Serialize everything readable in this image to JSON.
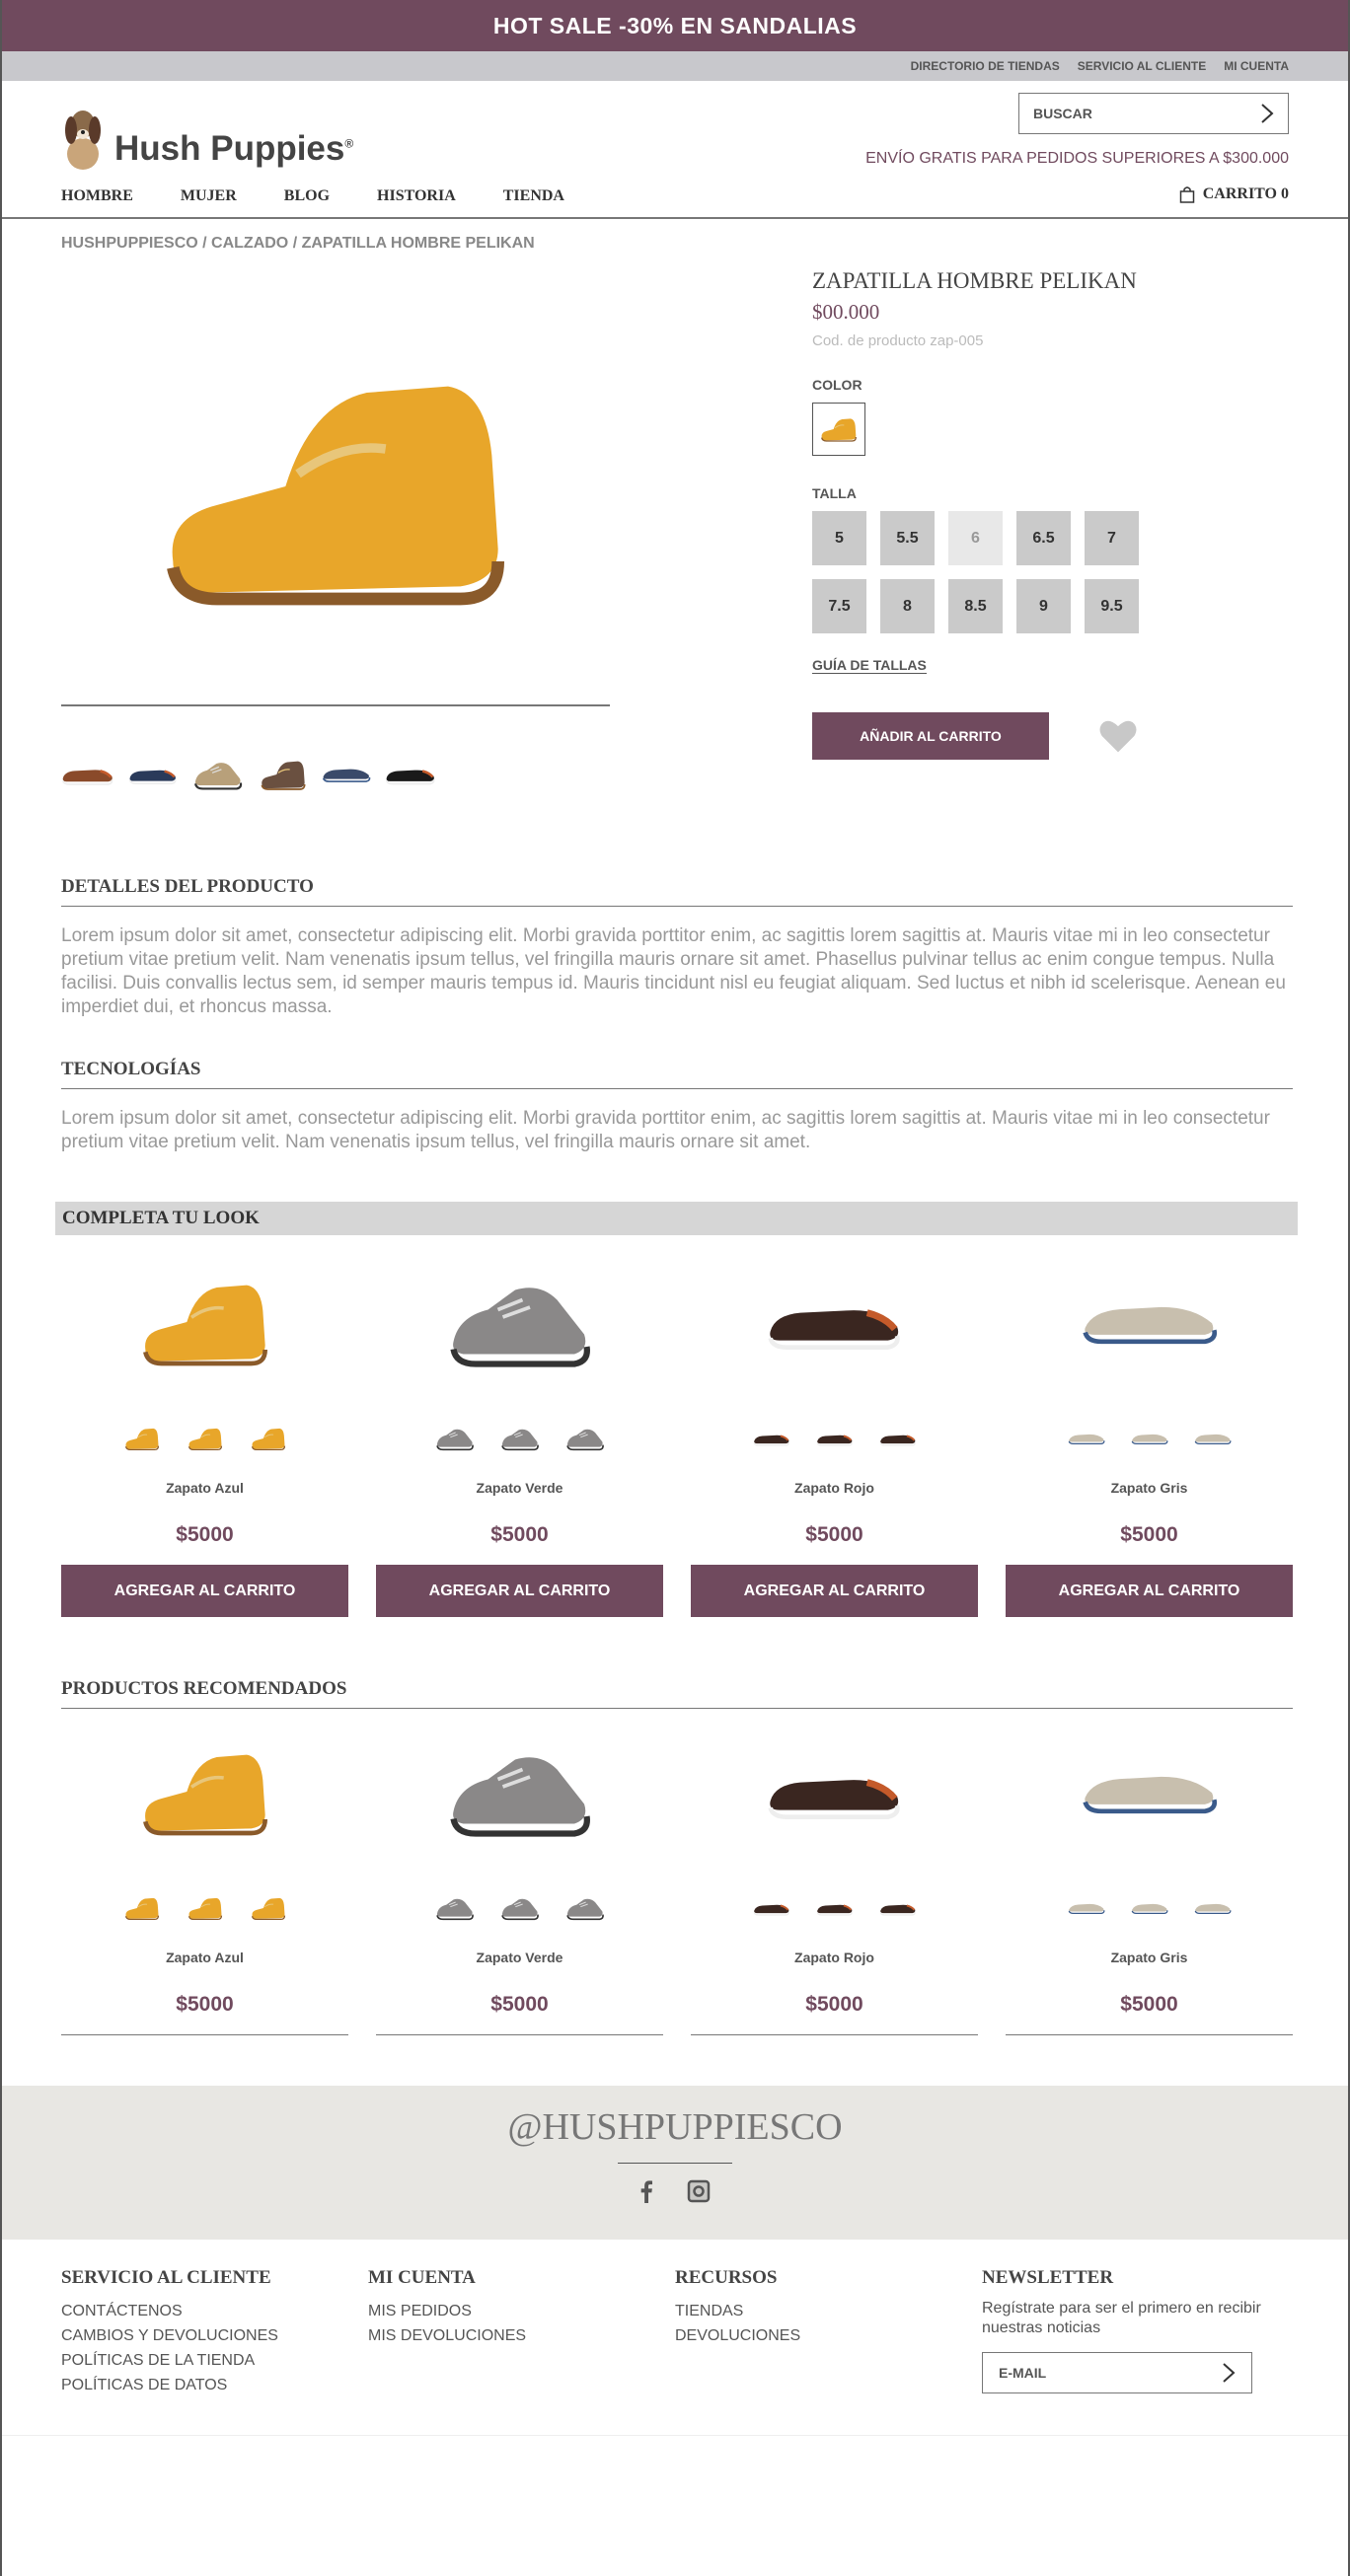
{
  "promo": "HOT SALE -30% EN SANDALIAS",
  "util_links": [
    "DIRECTORIO DE TIENDAS",
    "SERVICIO AL CLIENTE",
    "MI CUENTA"
  ],
  "brand": "Hush Puppies",
  "brand_mark": "®",
  "search": {
    "placeholder": "BUSCAR"
  },
  "shipping": "ENVÍO GRATIS PARA PEDIDOS SUPERIORES A $300.000",
  "nav": [
    "HOMBRE",
    "MUJER",
    "BLOG",
    "HISTORIA",
    "TIENDA"
  ],
  "cart": "CARRITO 0",
  "breadcrumb": "HUSHPUPPIESCO / CALZADO / ZAPATILLA HOMBRE PELIKAN",
  "product": {
    "name": "ZAPATILLA HOMBRE PELIKAN",
    "price": "$00.000",
    "code": "Cod. de producto zap-005",
    "color_label": "COLOR",
    "size_label": "TALLA",
    "sizes": [
      "5",
      "5.5",
      "6",
      "6.5",
      "7",
      "7.5",
      "8",
      "8.5",
      "9",
      "9.5"
    ],
    "guide": "GUÍA DE TALLAS",
    "add": "AÑADIR AL CARRITO"
  },
  "details": {
    "title": "DETALLES DEL PRODUCTO",
    "text": "Lorem ipsum dolor sit amet, consectetur adipiscing elit. Morbi gravida porttitor enim, ac sagittis lorem sagittis at. Mauris vitae mi in leo consectetur pretium vitae pretium velit. Nam venenatis ipsum tellus, vel fringilla mauris ornare sit amet. Phasellus pulvinar tellus ac enim congue tempus. Nulla facilisi. Duis convallis lectus sem, id semper mauris tempus id. Mauris tincidunt nisl eu feugiat aliquam. Sed luctus et nibh id scelerisque. Aenean eu imperdiet dui, et rhoncus massa."
  },
  "tech": {
    "title": "TECNOLOGÍAS",
    "text": "Lorem ipsum dolor sit amet, consectetur adipiscing elit. Morbi gravida porttitor enim, ac sagittis lorem sagittis at. Mauris vitae mi in leo consectetur pretium vitae pretium velit. Nam venenatis ipsum tellus, vel fringilla mauris ornare sit amet."
  },
  "look": {
    "title": "COMPLETA TU LOOK",
    "cards": [
      {
        "name": "Zapato Azul",
        "price": "$5000",
        "button": "AGREGAR AL CARRITO"
      },
      {
        "name": "Zapato Verde",
        "price": "$5000",
        "button": "AGREGAR AL CARRITO"
      },
      {
        "name": "Zapato Rojo",
        "price": "$5000",
        "button": "AGREGAR AL CARRITO"
      },
      {
        "name": "Zapato Gris",
        "price": "$5000",
        "button": "AGREGAR AL CARRITO"
      }
    ]
  },
  "recommended": {
    "title": "PRODUCTOS RECOMENDADOS",
    "cards": [
      {
        "name": "Zapato Azul",
        "price": "$5000"
      },
      {
        "name": "Zapato Verde",
        "price": "$5000"
      },
      {
        "name": "Zapato Rojo",
        "price": "$5000"
      },
      {
        "name": "Zapato Gris",
        "price": "$5000"
      }
    ]
  },
  "social": {
    "handle": "@HUSHPUPPIESCO",
    "icons": [
      "facebook-icon",
      "instagram-icon"
    ]
  },
  "footer": {
    "col1": {
      "title": "SERVICIO AL CLIENTE",
      "links": [
        "CONTÁCTENOS",
        "CAMBIOS Y DEVOLUCIONES",
        "POLÍTICAS DE LA TIENDA",
        "POLÍTICAS DE DATOS"
      ]
    },
    "col2": {
      "title": "MI CUENTA",
      "links": [
        "MIS PEDIDOS",
        "MIS DEVOLUCIONES"
      ]
    },
    "col3": {
      "title": "RECURSOS",
      "links": [
        "TIENDAS",
        "DEVOLUCIONES"
      ]
    },
    "col4": {
      "title": "NEWSLETTER",
      "text": "Regístrate para ser el primero en recibir nuestras noticias",
      "email_placeholder": "E-MAIL"
    }
  },
  "colors": {
    "accent": "#704a5e",
    "size_bg": "#cacaca",
    "look_bar": "#d6d6d6",
    "social_bg": "#e8e7e3"
  }
}
